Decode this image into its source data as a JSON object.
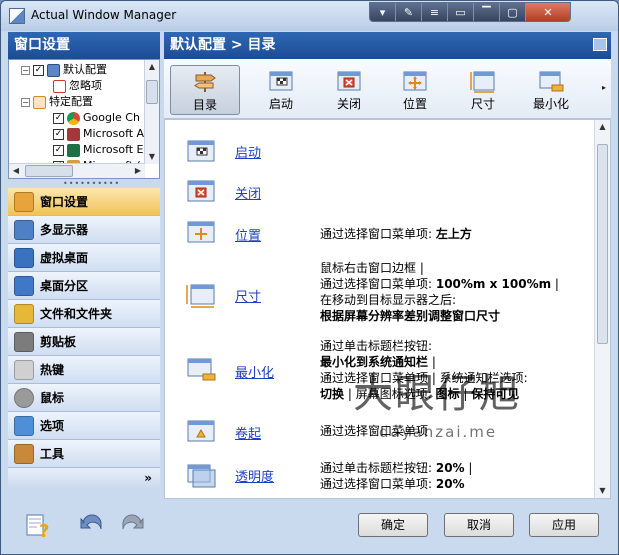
{
  "window": {
    "title": "Actual Window Manager"
  },
  "titlebar_buttons": [
    "▾",
    "✎",
    "≡",
    "▭",
    "▔",
    "▢",
    "✕"
  ],
  "left": {
    "header": "窗口设置",
    "tree": [
      {
        "label": "默认配置",
        "checked": true
      },
      {
        "label": "忽略项"
      },
      {
        "label": "特定配置"
      },
      {
        "label": "Google Ch",
        "checked": true
      },
      {
        "label": "Microsoft A",
        "checked": true
      },
      {
        "label": "Microsoft E",
        "checked": true
      },
      {
        "label": "Microsoft (",
        "checked": true
      }
    ],
    "grip": "••••••••••",
    "nav": [
      {
        "label": "窗口设置",
        "color": "#e8a33a"
      },
      {
        "label": "多显示器",
        "color": "#4f7fc4"
      },
      {
        "label": "虚拟桌面",
        "color": "#3a72c2"
      },
      {
        "label": "桌面分区",
        "color": "#3f78c8"
      },
      {
        "label": "文件和文件夹",
        "color": "#e7b73a"
      },
      {
        "label": "剪贴板",
        "color": "#7c7c7c"
      },
      {
        "label": "热键",
        "color": "#d0d0d0"
      },
      {
        "label": "鼠标",
        "color": "#9a9a9a"
      },
      {
        "label": "选项",
        "color": "#4f8fd8"
      },
      {
        "label": "工具",
        "color": "#c88a3a"
      }
    ],
    "more": "»"
  },
  "right": {
    "header": "默认配置 > 目录",
    "toolbar": [
      {
        "label": "目录"
      },
      {
        "label": "启动"
      },
      {
        "label": "关闭"
      },
      {
        "label": "位置"
      },
      {
        "label": "尺寸"
      },
      {
        "label": "最小化"
      }
    ],
    "toolbar_more": "▸",
    "rows": [
      {
        "link": "启动",
        "lines": []
      },
      {
        "link": "关闭",
        "lines": []
      },
      {
        "link": "位置",
        "lines": [
          [
            "通过选择窗口菜单项: ",
            "左上方"
          ]
        ]
      },
      {
        "link": "尺寸",
        "lines": [
          [
            "鼠标右击窗口边框 |",
            ""
          ],
          [
            " 通过选择窗口菜单项: ",
            "100%m x 100%m",
            " |"
          ],
          [
            " 在移动到目标显示器之后:",
            ""
          ],
          [
            "",
            "根据屏幕分辨率差别调整窗口尺寸"
          ]
        ]
      },
      {
        "link": "最小化",
        "lines": [
          [
            "通过单击标题栏按钮:",
            ""
          ],
          [
            "",
            "最小化到系统通知栏",
            " |"
          ],
          [
            " 通过选择窗口菜单项 | 系统通知栏选项:",
            ""
          ],
          [
            "",
            "切换",
            " | 屏幕图标选项: ",
            "图标",
            " | ",
            "保持可见"
          ]
        ]
      },
      {
        "link": "卷起",
        "lines": [
          [
            "通过选择窗口菜单项",
            ""
          ]
        ]
      },
      {
        "link": "透明度",
        "lines": [
          [
            "通过单击标题栏按钮: ",
            "20%",
            " |"
          ],
          [
            " 通过选择窗口菜单项: ",
            "20%"
          ]
        ]
      }
    ]
  },
  "watermark": {
    "big": "大眼仔旭",
    "small": "dayanzai.me"
  },
  "buttons": {
    "ok": "确定",
    "cancel": "取消",
    "apply": "应用"
  }
}
